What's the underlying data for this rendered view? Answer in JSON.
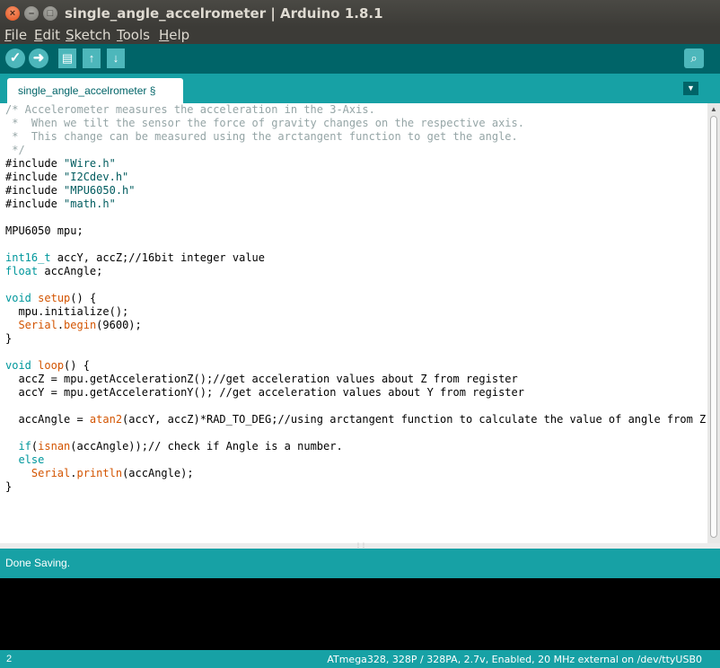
{
  "window": {
    "title": "single_angle_accelrometer | Arduino 1.8.1",
    "close_glyph": "×",
    "min_glyph": "–",
    "max_glyph": "□"
  },
  "menu": [
    {
      "accel": "F",
      "rest": "ile"
    },
    {
      "accel": "E",
      "rest": "dit"
    },
    {
      "accel": "S",
      "rest": "ketch"
    },
    {
      "accel": "T",
      "rest": "ools"
    },
    {
      "accel": "H",
      "rest": "elp"
    }
  ],
  "toolbar": {
    "verify_icon": "✓",
    "upload_icon": "➜",
    "new_icon": "▤",
    "open_icon": "↑",
    "save_icon": "↓",
    "serial_icon": "⌕",
    "accent": "#006468",
    "button_color": "#4db7bb"
  },
  "tabs": {
    "active_label": "single_angle_accelrometer §",
    "menu_glyph": "▼"
  },
  "editor": {
    "lines": [
      [
        {
          "t": "/* Accelerometer measures the acceleration in the 3-Axis.",
          "c": "com"
        }
      ],
      [
        {
          "t": " *  When we tilt the sensor the force of gravity changes on the respective axis.",
          "c": "com"
        }
      ],
      [
        {
          "t": " *  This change can be measured using the arctangent function to get the angle.",
          "c": "com"
        }
      ],
      [
        {
          "t": " */",
          "c": "com"
        }
      ],
      [
        {
          "t": "#include ",
          "c": ""
        },
        {
          "t": "\"Wire.h\"",
          "c": "str"
        }
      ],
      [
        {
          "t": "#include ",
          "c": ""
        },
        {
          "t": "\"I2Cdev.h\"",
          "c": "str"
        }
      ],
      [
        {
          "t": "#include ",
          "c": ""
        },
        {
          "t": "\"MPU6050.h\"",
          "c": "str"
        }
      ],
      [
        {
          "t": "#include ",
          "c": ""
        },
        {
          "t": "\"math.h\"",
          "c": "str"
        }
      ],
      [
        {
          "t": "",
          "c": ""
        }
      ],
      [
        {
          "t": "MPU6050 mpu;",
          "c": ""
        }
      ],
      [
        {
          "t": "",
          "c": ""
        }
      ],
      [
        {
          "t": "int16_t",
          "c": "kw"
        },
        {
          "t": " accY, accZ;",
          "c": ""
        },
        {
          "t": "//16bit integer value",
          "c": ""
        }
      ],
      [
        {
          "t": "float",
          "c": "kw"
        },
        {
          "t": " accAngle;",
          "c": ""
        }
      ],
      [
        {
          "t": "",
          "c": ""
        }
      ],
      [
        {
          "t": "void",
          "c": "kw"
        },
        {
          "t": " ",
          "c": ""
        },
        {
          "t": "setup",
          "c": "fn"
        },
        {
          "t": "() {",
          "c": ""
        }
      ],
      [
        {
          "t": "  mpu.initialize();",
          "c": ""
        }
      ],
      [
        {
          "t": "  ",
          "c": ""
        },
        {
          "t": "Serial",
          "c": "fn"
        },
        {
          "t": ".",
          "c": ""
        },
        {
          "t": "begin",
          "c": "fn"
        },
        {
          "t": "(9600);",
          "c": ""
        }
      ],
      [
        {
          "t": "}",
          "c": ""
        }
      ],
      [
        {
          "t": "",
          "c": ""
        }
      ],
      [
        {
          "t": "void",
          "c": "kw"
        },
        {
          "t": " ",
          "c": ""
        },
        {
          "t": "loop",
          "c": "fn"
        },
        {
          "t": "() {",
          "c": ""
        }
      ],
      [
        {
          "t": "  accZ = mpu.getAccelerationZ();//get acceleration values about Z from register",
          "c": ""
        }
      ],
      [
        {
          "t": "  accY = mpu.getAccelerationY(); //get acceleration values about Y from register",
          "c": ""
        }
      ],
      [
        {
          "t": "",
          "c": ""
        }
      ],
      [
        {
          "t": "  accAngle = ",
          "c": ""
        },
        {
          "t": "atan2",
          "c": "fn"
        },
        {
          "t": "(accY, accZ)*RAD_TO_DEG;//using arctangent function to calculate the value of angle from Z.",
          "c": ""
        }
      ],
      [
        {
          "t": "",
          "c": ""
        }
      ],
      [
        {
          "t": "  ",
          "c": ""
        },
        {
          "t": "if",
          "c": "kw"
        },
        {
          "t": "(",
          "c": ""
        },
        {
          "t": "isnan",
          "c": "fn"
        },
        {
          "t": "(accAngle));// check if Angle is a number.",
          "c": ""
        }
      ],
      [
        {
          "t": "  ",
          "c": ""
        },
        {
          "t": "else",
          "c": "kw"
        }
      ],
      [
        {
          "t": "    ",
          "c": ""
        },
        {
          "t": "Serial",
          "c": "fn"
        },
        {
          "t": ".",
          "c": ""
        },
        {
          "t": "println",
          "c": "fn"
        },
        {
          "t": "(accAngle);",
          "c": ""
        }
      ],
      [
        {
          "t": "}",
          "c": ""
        }
      ]
    ]
  },
  "status": {
    "message": "Done Saving."
  },
  "footer": {
    "line_number": "2",
    "board_info": "ATmega328, 328P / 328PA, 2.7v, Enabled, 20 MHz external on /dev/ttyUSB0"
  }
}
